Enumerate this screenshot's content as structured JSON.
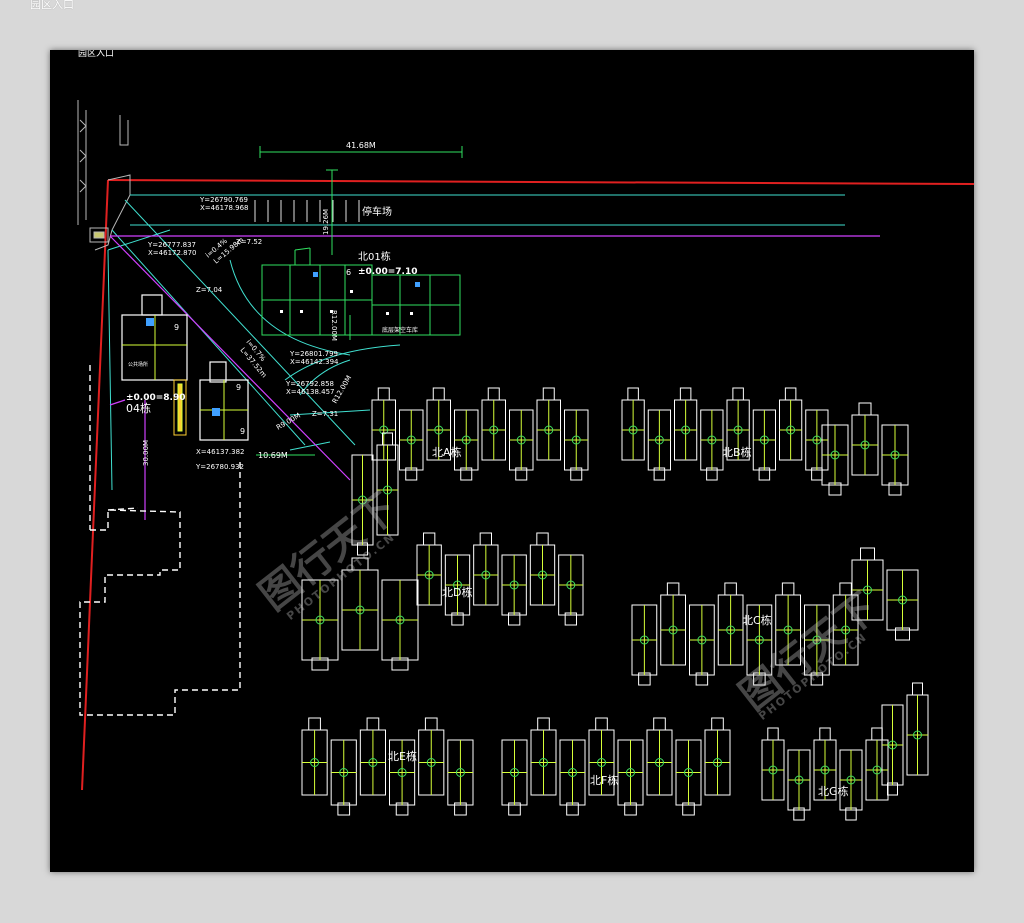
{
  "outer_label": "园区入口",
  "labels": {
    "entrance": "园区入口",
    "dim_top": "41.68M",
    "parking": "停车场",
    "dim_vertical": "19.26M",
    "coord1_y": "Y=26790.769",
    "coord1_x": "X=46178.968",
    "coord2_y": "Y=26777.837",
    "coord2_x": "X=46172.870",
    "z752": "Z=7.52",
    "i04": "i=0.4%",
    "l15": "L=15.98m",
    "z704": "Z=7.04",
    "b01": "北01栋",
    "elev01": "±0.00=7.10",
    "bottom_garage": "底层架空车库",
    "r12": "R12.00M",
    "coord3_y": "Y=26801.799",
    "coord3_x": "X=46142.394",
    "i07": "i=0.7%",
    "l37": "L=37.52m",
    "coord4_y": "Y=26792.858",
    "coord4_x": "X=46138.457",
    "z731": "Z=7.31",
    "r09": "R9.00M",
    "r_road": "R12.00M",
    "elev04": "±0.00=8.90",
    "b04": "04栋",
    "dim_30": "30.00M",
    "coord5_x": "X=46137.382",
    "coord5_y": "Y=26780.932",
    "dim_1069": "10.69M",
    "n9a": "9",
    "n9b": "9",
    "n9c": "9",
    "n6": "6",
    "room": "公共场所",
    "bA": "北A栋",
    "bB": "北B栋",
    "bC": "北C栋",
    "bD": "北D栋",
    "bE": "北E栋",
    "bF": "北F栋",
    "bG": "北G栋"
  },
  "watermark": {
    "logo": "图行天下",
    "url": "PHOTOPHOTO.CN"
  },
  "colors": {
    "background": "#000000",
    "wall": "#d7ff38",
    "outline": "#ffffff",
    "boundary": "#e02020",
    "guide": "#d040ff",
    "road": "#40e0d0",
    "text": "#ffffff"
  }
}
